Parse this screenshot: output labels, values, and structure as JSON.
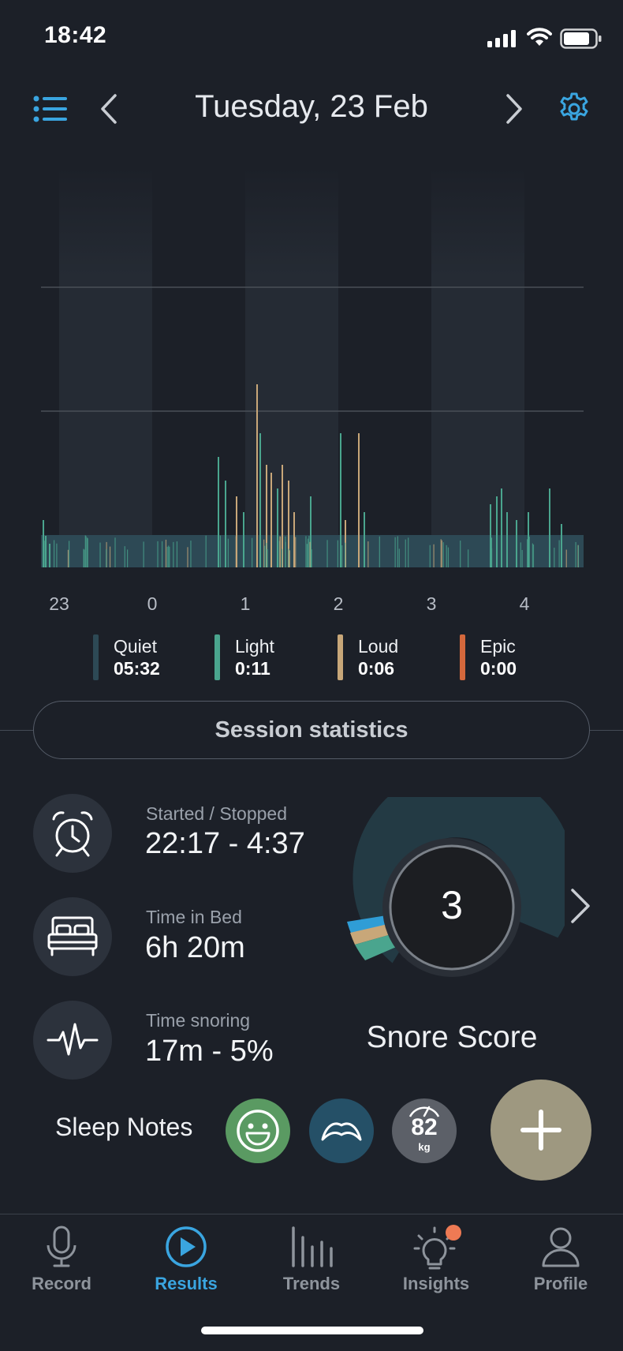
{
  "status_bar": {
    "time": "18:42"
  },
  "header": {
    "title": "Tuesday, 23 Feb"
  },
  "chart_data": {
    "type": "bar",
    "x_ticks": [
      "23",
      "0",
      "1",
      "2",
      "3",
      "4"
    ],
    "series": [
      {
        "name": "Quiet",
        "value": "05:32"
      },
      {
        "name": "Light",
        "value": "0:11"
      },
      {
        "name": "Loud",
        "value": "0:06"
      },
      {
        "name": "Epic",
        "value": "0:00"
      }
    ],
    "colors": {
      "Quiet": "#2d4955",
      "Light": "#4aa58e",
      "Loud": "#c8a779",
      "Epic": "#d4683c"
    }
  },
  "session_stats_label": "Session statistics",
  "stats": [
    {
      "label": "Started / Stopped",
      "value": "22:17 - 4:37",
      "icon": "alarm-clock-icon"
    },
    {
      "label": "Time in Bed",
      "value": "6h 20m",
      "icon": "bed-icon"
    },
    {
      "label": "Time snoring",
      "value": "17m - 5%",
      "icon": "heartbeat-icon"
    }
  ],
  "score": {
    "value": "3",
    "label": "Snore Score"
  },
  "sleep_notes": {
    "label": "Sleep Notes",
    "weight": {
      "value": "82",
      "unit": "kg"
    }
  },
  "tabs": [
    {
      "label": "Record",
      "icon": "microphone-icon"
    },
    {
      "label": "Results",
      "icon": "play-circle-icon"
    },
    {
      "label": "Trends",
      "icon": "bars-icon"
    },
    {
      "label": "Insights",
      "icon": "lightbulb-icon"
    },
    {
      "label": "Profile",
      "icon": "person-icon"
    }
  ],
  "active_tab": "Results",
  "accent_color": "#3aa5e0"
}
